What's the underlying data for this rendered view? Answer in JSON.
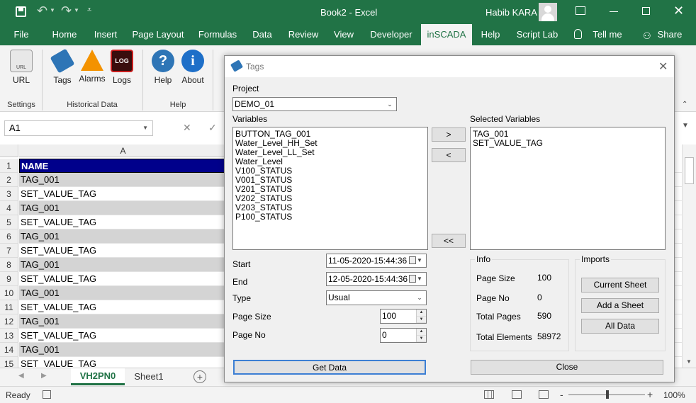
{
  "window": {
    "file_title": "Book2",
    "separator": "-",
    "app_name": "Excel",
    "user_name": "Habib KARA"
  },
  "ribbon_tabs": [
    "File",
    "Home",
    "Insert",
    "Page Layout",
    "Formulas",
    "Data",
    "Review",
    "View",
    "Developer",
    "inSCADA",
    "Help",
    "Script Lab",
    "Tell me",
    "Share"
  ],
  "ribbon": {
    "settings": {
      "url_label": "URL",
      "group_label": "Settings"
    },
    "historical": {
      "tags_label": "Tags",
      "alarms_label": "Alarms",
      "logs_label": "Logs",
      "log_icon_text": "LOG",
      "group_label": "Historical Data"
    },
    "help": {
      "help_label": "Help",
      "about_label": "About",
      "group_label": "Help"
    }
  },
  "formula_bar": {
    "name_box": "A1"
  },
  "grid": {
    "column_header": "A",
    "rows": [
      {
        "num": "1",
        "value": "NAME"
      },
      {
        "num": "2",
        "value": "TAG_001"
      },
      {
        "num": "3",
        "value": "SET_VALUE_TAG"
      },
      {
        "num": "4",
        "value": "TAG_001"
      },
      {
        "num": "5",
        "value": "SET_VALUE_TAG"
      },
      {
        "num": "6",
        "value": "TAG_001"
      },
      {
        "num": "7",
        "value": "SET_VALUE_TAG"
      },
      {
        "num": "8",
        "value": "TAG_001"
      },
      {
        "num": "9",
        "value": "SET_VALUE_TAG"
      },
      {
        "num": "10",
        "value": "TAG_001"
      },
      {
        "num": "11",
        "value": "SET_VALUE_TAG"
      },
      {
        "num": "12",
        "value": "TAG_001"
      },
      {
        "num": "13",
        "value": "SET_VALUE_TAG"
      },
      {
        "num": "14",
        "value": "TAG_001"
      },
      {
        "num": "15",
        "value": "SET_VALUE_TAG"
      }
    ]
  },
  "sheets": {
    "active": "VH2PN0",
    "other": "Sheet1",
    "add": "+"
  },
  "status": {
    "ready": "Ready",
    "zoom": "100%",
    "minus": "-",
    "plus": "+"
  },
  "dialog": {
    "title": "Tags",
    "project_label": "Project",
    "project_value": "DEMO_01",
    "variables_label": "Variables",
    "variables": [
      "BUTTON_TAG_001",
      "Water_Level_HH_Set",
      "Water_Level_LL_Set",
      "Water_Level",
      "V100_STATUS",
      "V001_STATUS",
      "V201_STATUS",
      "V202_STATUS",
      "V203_STATUS",
      "P100_STATUS"
    ],
    "selected_label": "Selected Variables",
    "selected": [
      "TAG_001",
      "SET_VALUE_TAG"
    ],
    "add_button": ">",
    "remove_button": "<",
    "remove_all_button": "<<",
    "start_label": "Start",
    "start_value": "11-05-2020-15:44:36",
    "end_label": "End",
    "end_value": "12-05-2020-15:44:36",
    "type_label": "Type",
    "type_value": "Usual",
    "page_size_label": "Page Size",
    "page_size_value": "100",
    "page_no_label": "Page No",
    "page_no_value": "0",
    "info": {
      "title": "Info",
      "page_size_label": "Page Size",
      "page_size_value": "100",
      "page_no_label": "Page No",
      "page_no_value": "0",
      "total_pages_label": "Total Pages",
      "total_pages_value": "590",
      "total_elements_label": "Total Elements",
      "total_elements_value": "58972"
    },
    "imports": {
      "title": "Imports",
      "current_sheet": "Current Sheet",
      "add_sheet": "Add a Sheet",
      "all_data": "All Data"
    },
    "get_data_button": "Get Data",
    "close_button": "Close"
  },
  "colors": {
    "excel_green": "#217346",
    "header_cell": "#00008b",
    "gray_row": "#d4d4d4"
  }
}
